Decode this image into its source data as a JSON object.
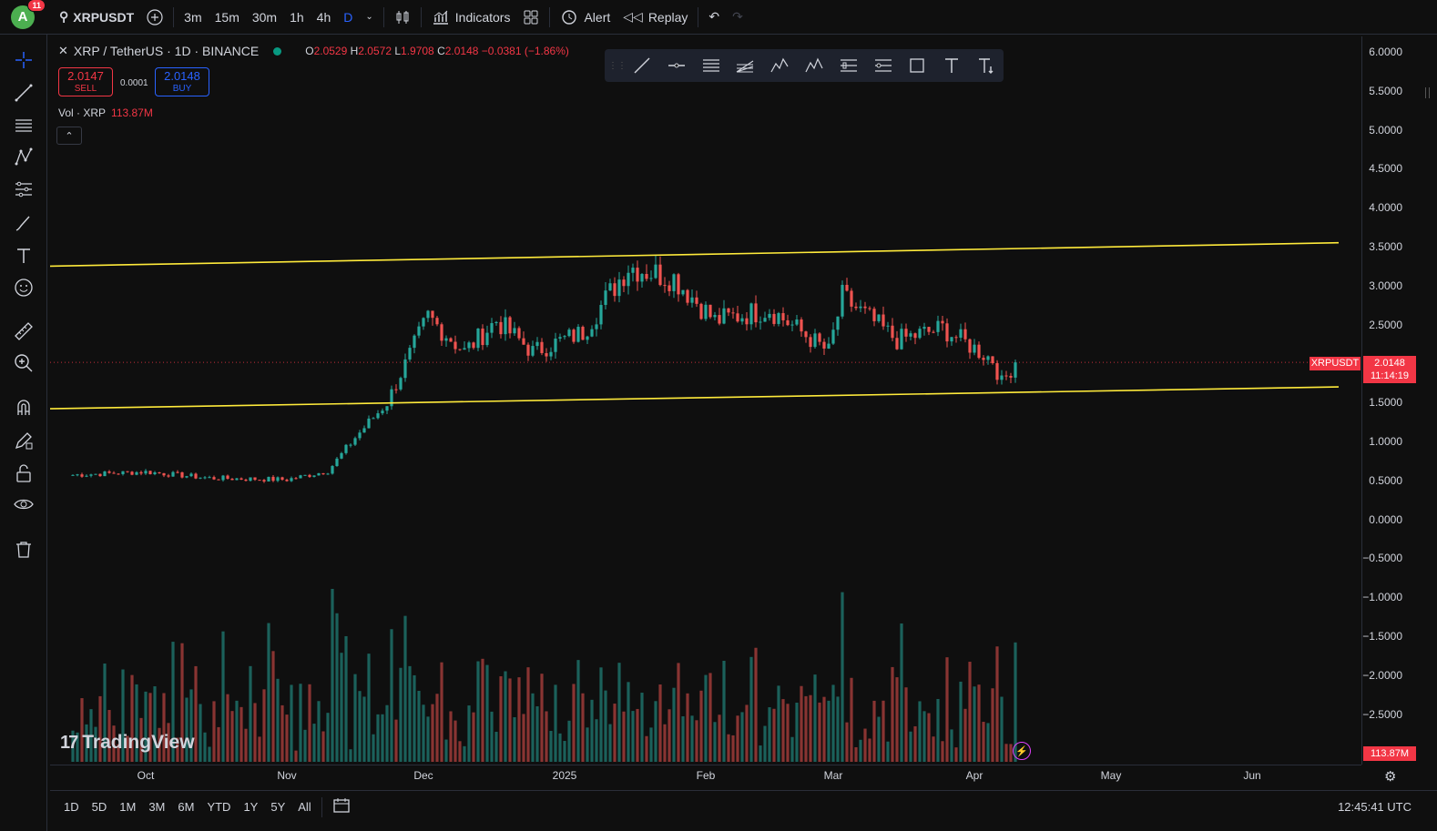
{
  "topbar": {
    "avatar_letter": "A",
    "notifications": "11",
    "symbol": "XRPUSDT",
    "timeframes": [
      "3m",
      "15m",
      "30m",
      "1h",
      "4h",
      "D"
    ],
    "indicators_label": "Indicators",
    "alert_label": "Alert",
    "replay_label": "Replay"
  },
  "legend": {
    "title": "XRP / TetherUS · 1D · BINANCE",
    "o_label": "O",
    "o": "2.0529",
    "h_label": "H",
    "h": "2.0572",
    "l_label": "L",
    "l": "1.9708",
    "c_label": "C",
    "c": "2.0148",
    "change": "−0.0381 (−1.86%)",
    "sell_price": "2.0147",
    "sell_label": "SELL",
    "spread": "0.0001",
    "buy_price": "2.0148",
    "buy_label": "BUY",
    "vol_label": "Vol · XRP",
    "vol_value": "113.87M"
  },
  "price_axis": {
    "ticks": [
      "6.0000",
      "5.5000",
      "5.0000",
      "4.5000",
      "4.0000",
      "3.5000",
      "3.0000",
      "2.5000",
      "1.5000",
      "1.0000",
      "0.5000",
      "0.0000",
      "−0.5000",
      "−1.0000",
      "−1.5000",
      "−2.0000",
      "−2.5000"
    ],
    "last_price": "2.0148",
    "countdown": "11:14:19",
    "symbol_label": "XRPUSDT",
    "volume_label": "113.87M"
  },
  "time_axis": {
    "ticks": [
      "Oct",
      "Nov",
      "Dec",
      "2025",
      "Feb",
      "Mar",
      "Apr",
      "May",
      "Jun"
    ]
  },
  "bottombar": {
    "ranges": [
      "1D",
      "5D",
      "1M",
      "3M",
      "6M",
      "YTD",
      "1Y",
      "5Y",
      "All"
    ],
    "clock": "12:45:41 UTC"
  },
  "watermark": "TradingView",
  "colors": {
    "up": "#26a69a",
    "down": "#ef5350",
    "channel": "#ffeb3b",
    "accent": "#2962ff"
  },
  "chart_data": {
    "type": "candlestick",
    "series_daily_close_approx": [
      {
        "x": "2024-09-15",
        "close": 0.57
      },
      {
        "x": "2024-10-01",
        "close": 0.61
      },
      {
        "x": "2024-10-15",
        "close": 0.53
      },
      {
        "x": "2024-11-01",
        "close": 0.51
      },
      {
        "x": "2024-11-10",
        "close": 0.62
      },
      {
        "x": "2024-11-16",
        "close": 1.05
      },
      {
        "x": "2024-11-23",
        "close": 1.5
      },
      {
        "x": "2024-12-02",
        "close": 2.6
      },
      {
        "x": "2024-12-10",
        "close": 2.15
      },
      {
        "x": "2024-12-17",
        "close": 2.55
      },
      {
        "x": "2024-12-25",
        "close": 2.15
      },
      {
        "x": "2025-01-05",
        "close": 2.4
      },
      {
        "x": "2025-01-15",
        "close": 3.25
      },
      {
        "x": "2025-01-25",
        "close": 3.1
      },
      {
        "x": "2025-02-03",
        "close": 2.55
      },
      {
        "x": "2025-02-15",
        "close": 2.7
      },
      {
        "x": "2025-02-28",
        "close": 2.15
      },
      {
        "x": "2025-03-03",
        "close": 2.85
      },
      {
        "x": "2025-03-15",
        "close": 2.3
      },
      {
        "x": "2025-03-25",
        "close": 2.45
      },
      {
        "x": "2025-04-05",
        "close": 2.05
      },
      {
        "x": "2025-04-07",
        "close": 1.75
      },
      {
        "x": "2025-04-10",
        "close": 2.0148
      }
    ],
    "channel_lines": [
      {
        "from": {
          "x": "2024-09-10",
          "y": 3.25
        },
        "to": {
          "x": "2025-06-20",
          "y": 3.55
        }
      },
      {
        "from": {
          "x": "2024-09-10",
          "y": 1.42
        },
        "to": {
          "x": "2025-06-20",
          "y": 1.7
        }
      }
    ],
    "ylim": [
      -2.5,
      6.0
    ]
  }
}
